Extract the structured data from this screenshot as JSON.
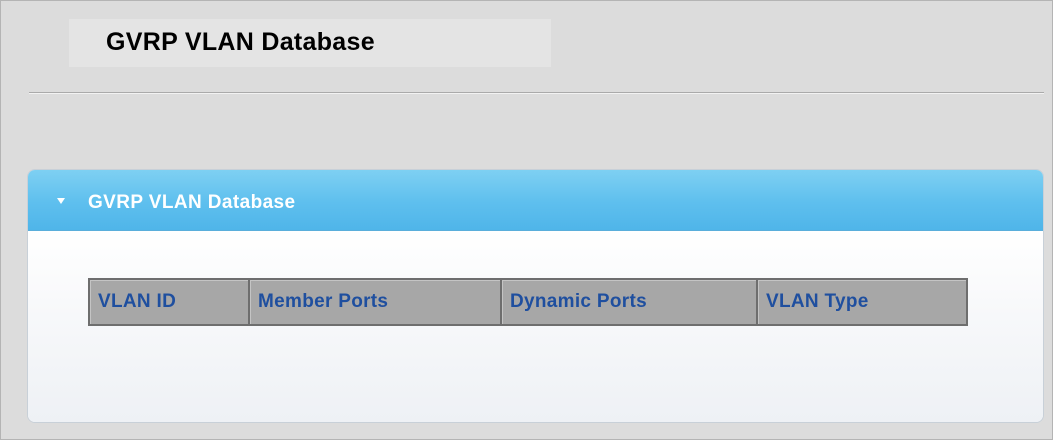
{
  "page": {
    "title": "GVRP VLAN Database"
  },
  "panel": {
    "header_icon": "collapse-triangle-icon",
    "title": "GVRP VLAN Database",
    "colors": {
      "header": "#5ebfee",
      "header_text": "#ffffff"
    }
  },
  "table": {
    "columns": [
      "VLAN ID",
      "Member Ports",
      "Dynamic Ports",
      "VLAN Type"
    ],
    "rows": [],
    "colors": {
      "header_bg": "#a7a7a7",
      "header_text": "#1f4f9f"
    }
  }
}
